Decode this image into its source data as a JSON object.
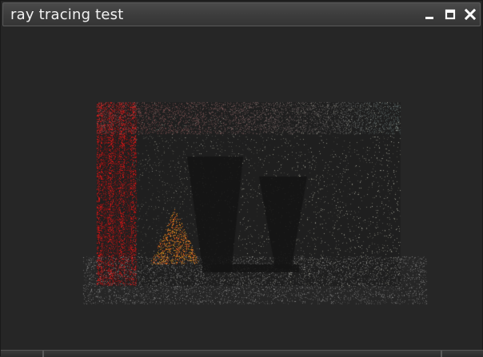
{
  "window": {
    "title": "ray tracing test"
  },
  "controls": {
    "minimize_icon": "minimize-icon",
    "maximize_icon": "maximize-icon",
    "close_icon": "close-icon"
  },
  "render": {
    "description_colors": {
      "background": "#262626",
      "left_wall": "#b01818",
      "noise_light": "#9a9a90"
    }
  }
}
